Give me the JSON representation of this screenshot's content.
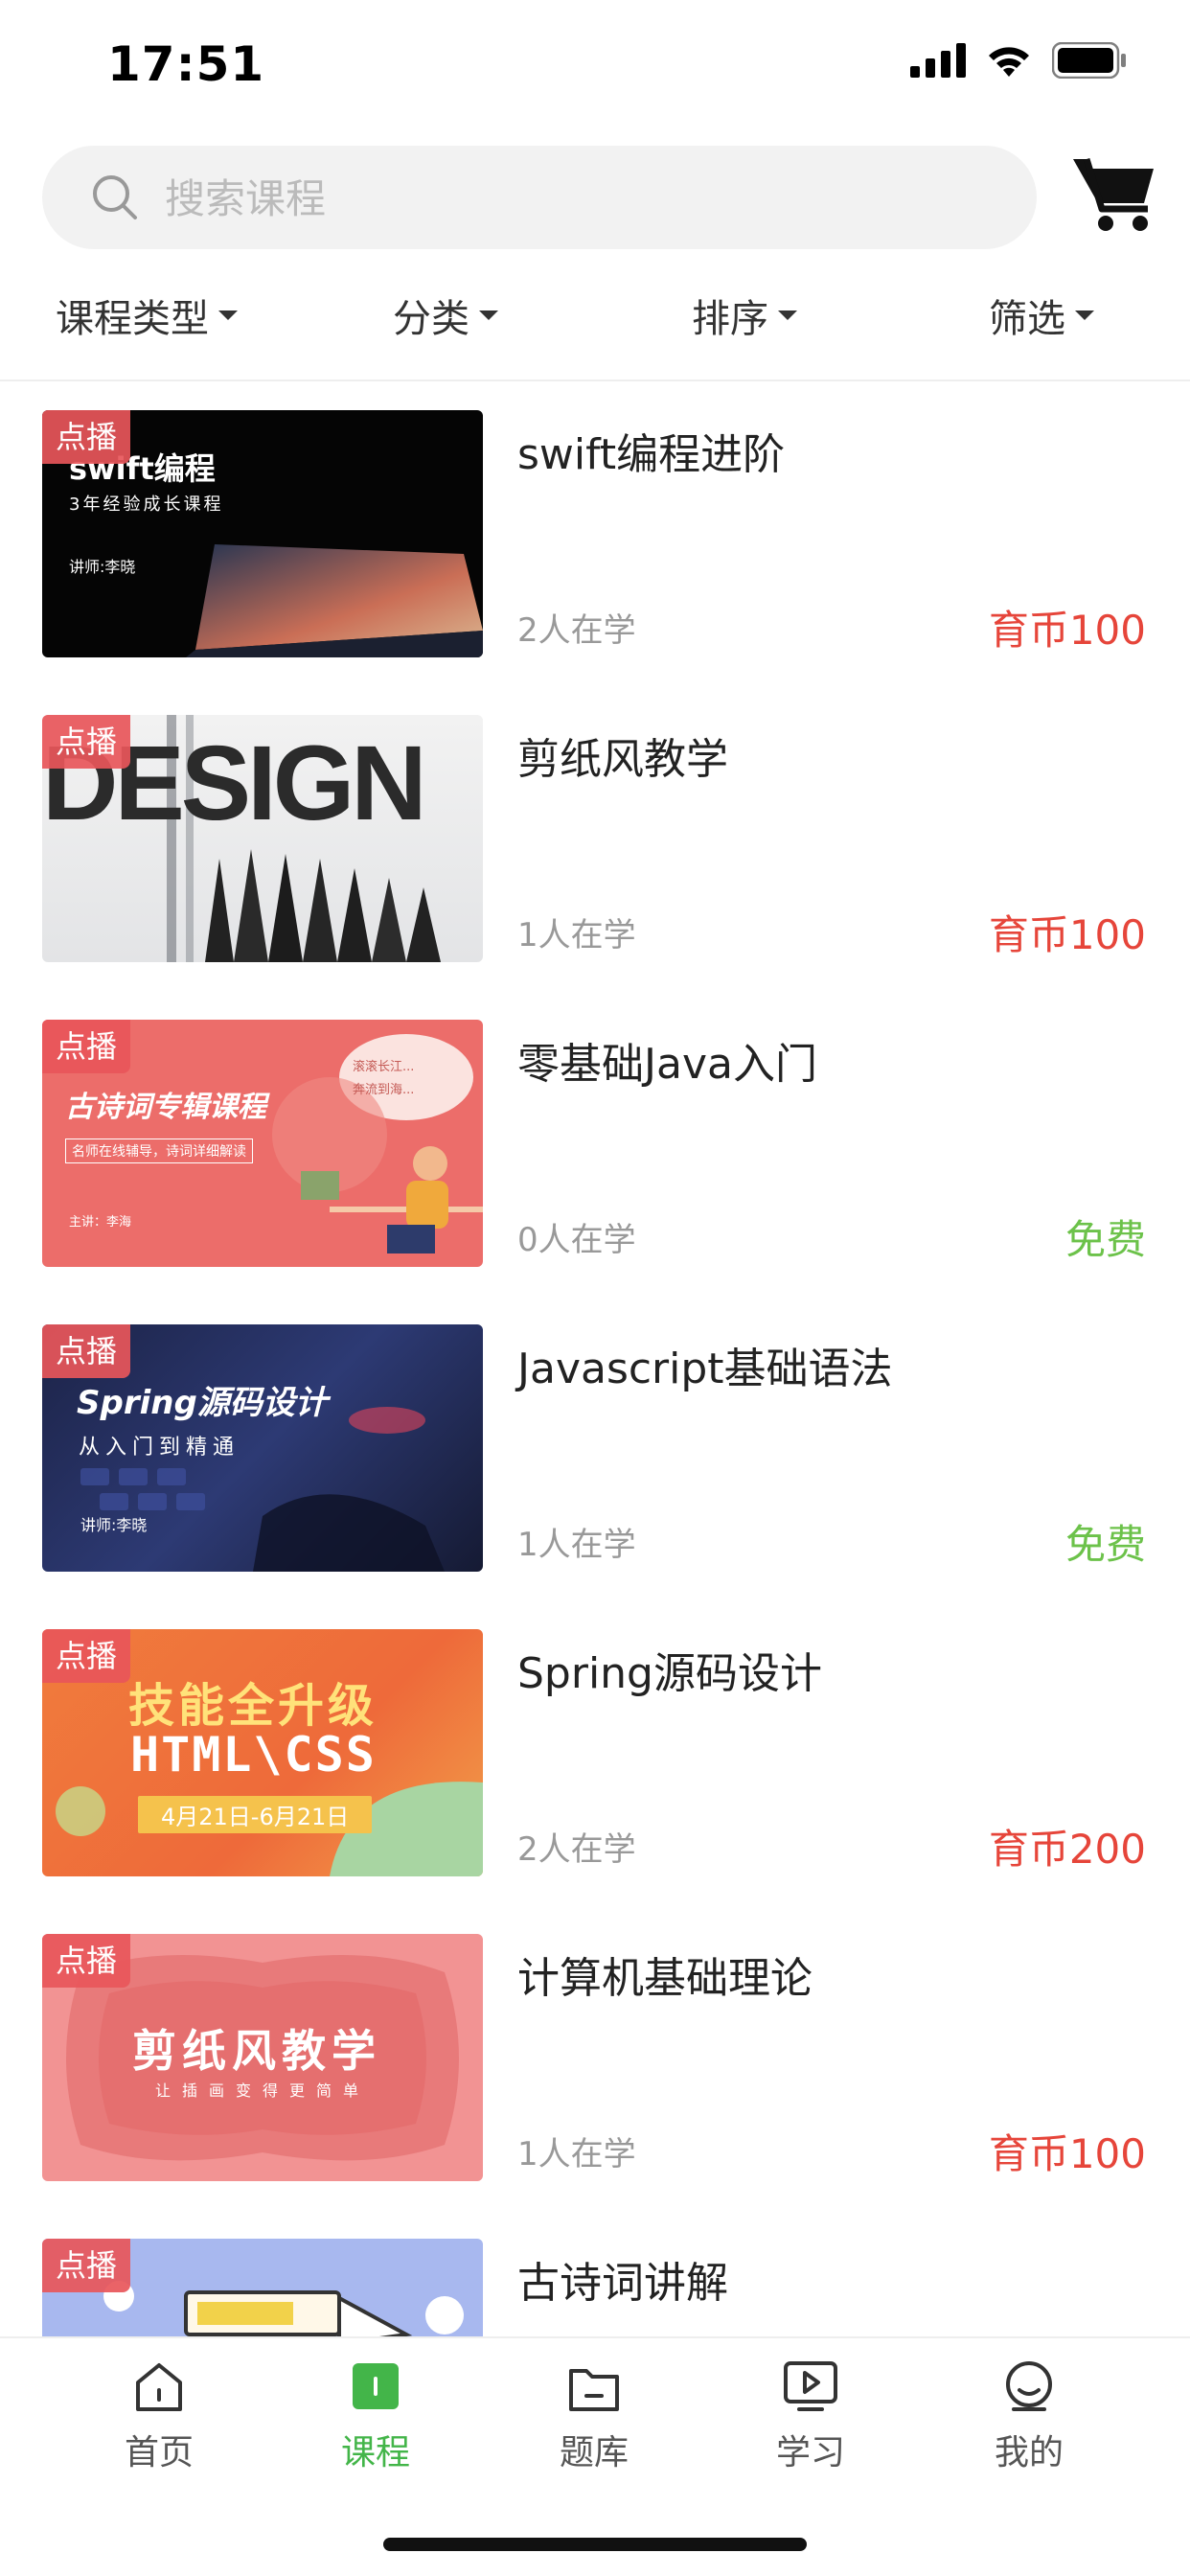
{
  "status_bar": {
    "time": "17:51"
  },
  "search": {
    "placeholder": "搜索课程",
    "value": ""
  },
  "filters": [
    {
      "label": "课程类型"
    },
    {
      "label": "分类"
    },
    {
      "label": "排序"
    },
    {
      "label": "筛选"
    }
  ],
  "courses": [
    {
      "badge": "点播",
      "title": "swift编程进阶",
      "learners": "2人在学",
      "price": "育币100",
      "price_type": "paid",
      "thumb_text": [
        "swift编程",
        "3年经验成长课程",
        "讲师:李晓"
      ]
    },
    {
      "badge": "点播",
      "title": "剪纸风教学",
      "learners": "1人在学",
      "price": "育币100",
      "price_type": "paid",
      "thumb_text": [
        "DESIGN"
      ]
    },
    {
      "badge": "点播",
      "title": "零基础Java入门",
      "learners": "0人在学",
      "price": "免费",
      "price_type": "free",
      "thumb_text": [
        "古诗词专辑课程",
        "名师在线辅导，诗词详细解读",
        "主讲：李海",
        "滚滚长江...",
        "奔流到海..."
      ]
    },
    {
      "badge": "点播",
      "title": "Javascript基础语法",
      "learners": "1人在学",
      "price": "免费",
      "price_type": "free",
      "thumb_text": [
        "Spring源码设计",
        "从入门到精通",
        "讲师:李晓"
      ]
    },
    {
      "badge": "点播",
      "title": "Spring源码设计",
      "learners": "2人在学",
      "price": "育币200",
      "price_type": "paid",
      "thumb_text": [
        "技能全升级",
        "HTML\\CSS",
        "4月21日-6月21日"
      ]
    },
    {
      "badge": "点播",
      "title": "计算机基础理论",
      "learners": "1人在学",
      "price": "育币100",
      "price_type": "paid",
      "thumb_text": [
        "剪纸风教学",
        "让插画变得更简单"
      ]
    },
    {
      "badge": "点播",
      "title": "古诗词讲解",
      "learners": "",
      "price": "",
      "price_type": "paid",
      "thumb_text": []
    }
  ],
  "tabs": [
    {
      "label": "首页",
      "icon": "home-icon",
      "active": false
    },
    {
      "label": "课程",
      "icon": "course-icon",
      "active": true
    },
    {
      "label": "题库",
      "icon": "question-bank-icon",
      "active": false
    },
    {
      "label": "学习",
      "icon": "study-play-icon",
      "active": false
    },
    {
      "label": "我的",
      "icon": "profile-icon",
      "active": false
    }
  ],
  "colors": {
    "accent_green": "#43b549",
    "price_red": "#e6453a",
    "free_green": "#6cc24a",
    "badge_red": "#e8565a"
  }
}
